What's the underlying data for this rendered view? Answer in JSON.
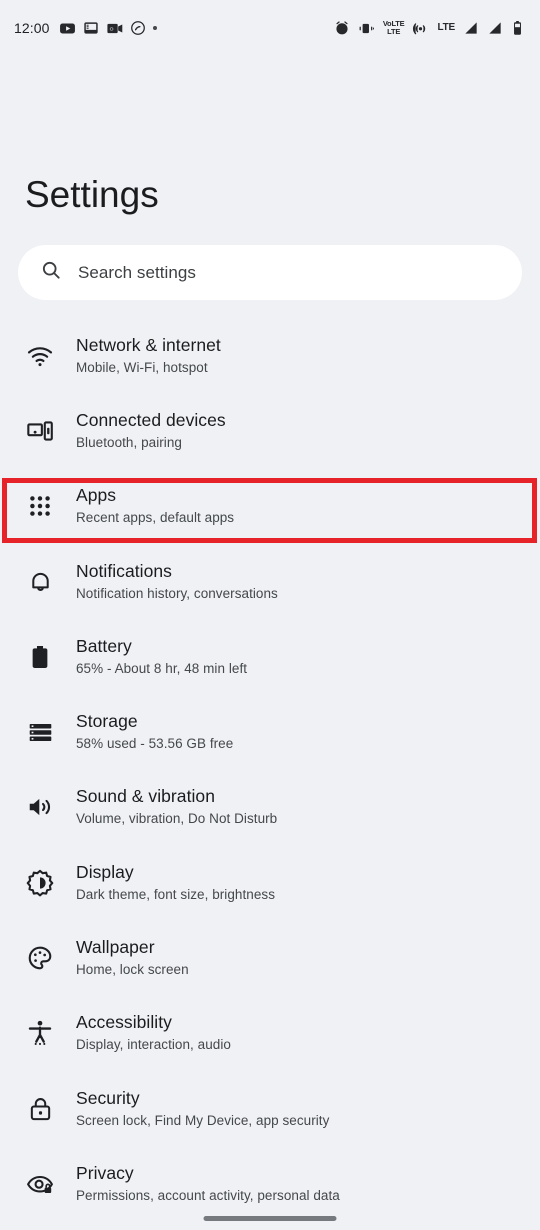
{
  "status_bar": {
    "clock": "12:00",
    "left_icons": [
      "youtube-icon",
      "screen-record-icon",
      "outlook-icon",
      "shazam-icon",
      "more-notifications-dot"
    ],
    "right_icons": [
      "alarm-icon",
      "vibrate-icon",
      "volte-icon",
      "hotspot-icon",
      "lte-label",
      "signal-bars-1-icon",
      "signal-bars-2-icon",
      "battery-icon"
    ],
    "volte_top": "VoLTE",
    "volte_bottom": "LTE",
    "network_label": "LTE"
  },
  "header": {
    "title": "Settings"
  },
  "search": {
    "placeholder": "Search settings",
    "icon": "search-icon"
  },
  "highlight": {
    "target": "Apps",
    "color": "#e52329"
  },
  "colors": {
    "background": "#eff1f5",
    "search_background": "#ffffff",
    "title_text": "#1b1c1e",
    "subtitle_text": "#45484b",
    "highlight_red": "#e52329",
    "nav_pill": "#76797d"
  },
  "list": {
    "items": [
      {
        "icon": "wifi-icon",
        "title": "Network & internet",
        "subtitle": "Mobile, Wi-Fi, hotspot"
      },
      {
        "icon": "connected-devices-icon",
        "title": "Connected devices",
        "subtitle": "Bluetooth, pairing"
      },
      {
        "icon": "apps-grid-icon",
        "title": "Apps",
        "subtitle": "Recent apps, default apps"
      },
      {
        "icon": "bell-icon",
        "title": "Notifications",
        "subtitle": "Notification history, conversations"
      },
      {
        "icon": "battery-icon",
        "title": "Battery",
        "subtitle": "65% - About 8 hr, 48 min left"
      },
      {
        "icon": "storage-icon",
        "title": "Storage",
        "subtitle": "58% used - 53.56 GB free"
      },
      {
        "icon": "volume-icon",
        "title": "Sound & vibration",
        "subtitle": "Volume, vibration, Do Not Disturb"
      },
      {
        "icon": "brightness-icon",
        "title": "Display",
        "subtitle": "Dark theme, font size, brightness"
      },
      {
        "icon": "palette-icon",
        "title": "Wallpaper",
        "subtitle": "Home, lock screen"
      },
      {
        "icon": "accessibility-icon",
        "title": "Accessibility",
        "subtitle": "Display, interaction, audio"
      },
      {
        "icon": "lock-icon",
        "title": "Security",
        "subtitle": "Screen lock, Find My Device, app security"
      },
      {
        "icon": "eye-lock-icon",
        "title": "Privacy",
        "subtitle": "Permissions, account activity, personal data"
      }
    ]
  },
  "nav": {
    "pill": "gesture-nav-pill"
  }
}
